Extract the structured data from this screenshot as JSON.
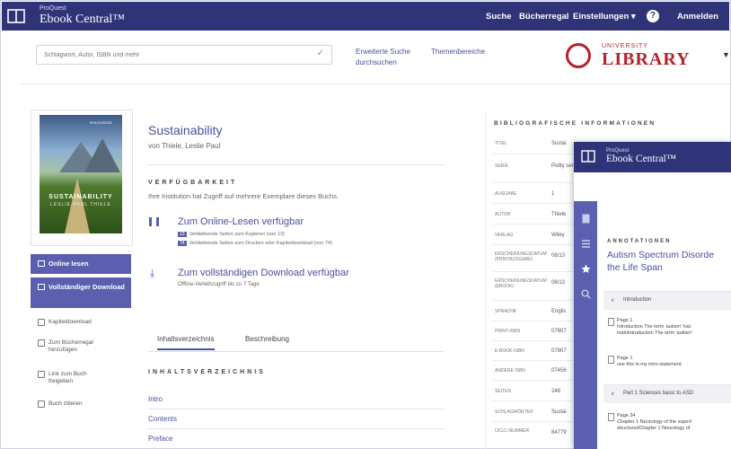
{
  "header": {
    "brand_small": "ProQuest",
    "brand": "Ebook Central™",
    "nav": [
      "Suche",
      "Bücherregal",
      "Einstellungen ▾",
      "Anmelden"
    ],
    "help_label": "?"
  },
  "search": {
    "placeholder": "Schlagwort, Autor, ISBN und mehr",
    "advanced_line1": "Erweiterte Suche",
    "advanced_line2": "durchsuchen",
    "topics": "Themenbereiche"
  },
  "library_logo": {
    "univ": "UNIVERSITY",
    "name": "LIBRARY"
  },
  "book": {
    "cover_publisher": "ROUTLEDGE",
    "cover_title": "SUSTAINABILITY",
    "cover_author": "LESLIE PAUL THIELE",
    "title": "Sustainability",
    "author": "von Thiele, Leslie Paul"
  },
  "actions": {
    "read_online": "Online lesen",
    "full_download": "Vollständiger Download",
    "chapter_download": "Kapiteldownload",
    "add_shelf": "Zum Bücherregal hinzufügen",
    "link_book": "Link zum Buch freigeben",
    "cite": "Buch zitieren"
  },
  "availability": {
    "heading": "VERFÜGBARKEIT",
    "text": "Ihre Institution hat Zugriff auf mehrere Exemplare dieses Buchs.",
    "read_link": "Zum Online-Lesen verfügbar",
    "copy_num": "13",
    "copy_text": "Verbleibende Seiten zum Kopieren (von 13)",
    "print_num": "74",
    "print_text": "Verbleibende Seiten zum Drucken oder Kapiteldownload (von 74)",
    "download_link": "Zum vollständigen Download verfügbar",
    "download_note": "Offline-Verleihzugriff bis zu 7 Tage"
  },
  "tabs": [
    "Inhaltsverzeichnis",
    "Beschreibung"
  ],
  "toc": {
    "heading": "INHALTSVERZEICHNIS",
    "items": [
      "Intro",
      "Contents",
      "Preface"
    ]
  },
  "bib": {
    "heading": "BIBLIOGRAFISCHE INFORMATIONEN",
    "rows": [
      {
        "label": "TITEL",
        "value": "Sustai"
      },
      {
        "label": "SERIE",
        "value": "Polity series"
      },
      {
        "label": "AUSGABE",
        "value": "1"
      },
      {
        "label": "AUTOR",
        "value": "Thiele"
      },
      {
        "label": "VERLAG",
        "value": "Wiley"
      },
      {
        "label": "ERSCHEINUNGSDATUM (PRINTAUSGABE)",
        "value": "06/13"
      },
      {
        "label": "ERSCHEINUNGSDATUM (EBOOK)",
        "value": "06/13"
      },
      {
        "label": "SPRACHE",
        "value": "Englis"
      },
      {
        "label": "PRINT-ISBN",
        "value": "07807"
      },
      {
        "label": "E-BOOK-ISBN",
        "value": "07807"
      },
      {
        "label": "ANDERE ISBN",
        "value": "07456"
      },
      {
        "label": "SEITEN",
        "value": "248"
      },
      {
        "label": "SCHLAGWÖRTER",
        "value": "Sustai"
      },
      {
        "label": "OCLC-NUMMER",
        "value": "84779"
      }
    ]
  },
  "overlay": {
    "brand_small": "ProQuest",
    "brand": "Ebook Central™",
    "heading": "ANNOTATIONEN",
    "title_line1": "Autism Spectrum Disorde",
    "title_line2": "the Life Span",
    "sections": [
      {
        "label": "Introduction"
      },
      {
        "label": "Part 1 Sciences basic to ASD"
      }
    ],
    "notes": [
      {
        "line1": "Page 1",
        "line2": "Introduction The term 'autism' has",
        "line3": "mainIntroduction The term 'autism'"
      },
      {
        "line1": "Page 1",
        "line2": "use this in my intro statement"
      },
      {
        "line1": "Page 34",
        "line2": "Chapter 1 Neurology of the superf",
        "line3": "structuredChapter 1 Neurology of"
      }
    ]
  },
  "colors": {
    "nav": "#2f3479",
    "accent": "#5c5fb0",
    "link": "#4a4f9c",
    "library": "#b5212d"
  }
}
